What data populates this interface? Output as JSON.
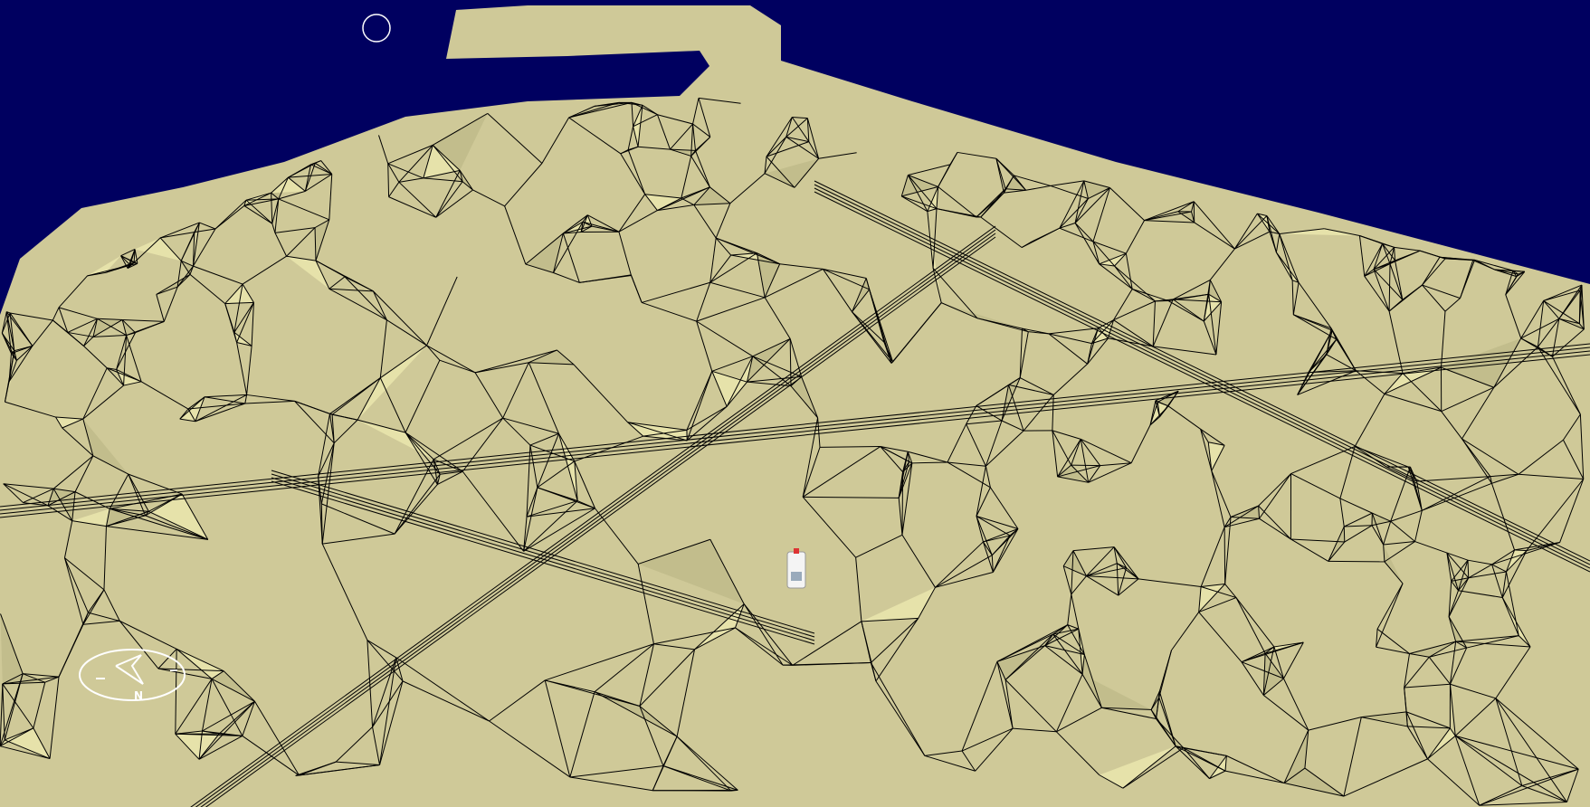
{
  "viewport": {
    "sky_color": "#000060",
    "terrain_color": "#cfc998",
    "terrain_light": "#e6e2aa",
    "mesh_color": "#000000"
  },
  "compass": {
    "north_label": "N",
    "icon": "compass-icon"
  },
  "cursor_marker": {
    "icon": "circle-cursor-icon"
  },
  "vehicle": {
    "icon": "vehicle-icon"
  }
}
